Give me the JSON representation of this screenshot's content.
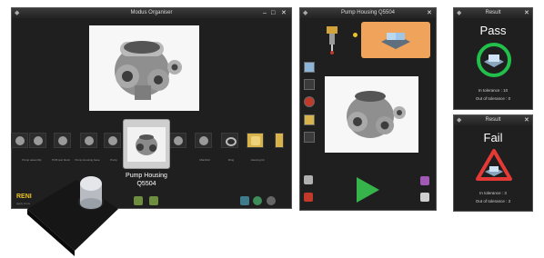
{
  "organiser": {
    "title": "Modus Organiser",
    "selected_name": "Pump Housing",
    "selected_code": "Q5504",
    "thumb_labels": [
      "Pump assembly",
      "PCB test block",
      "Pump Housing base",
      "Pump",
      "Pump",
      "Bracket",
      "Manifold",
      "Ring",
      "Collar",
      "Spare",
      "Housing lid"
    ],
    "brand": "RENI",
    "brand_sub": "apply innov"
  },
  "program": {
    "title": "Pump Housing Q5504"
  },
  "result_pass": {
    "title": "Result",
    "status": "Pass",
    "in_tol": "In tolerance : 10",
    "out_tol": "Out of tolerance : 0",
    "accent": "#22c04a"
  },
  "result_fail": {
    "title": "Result",
    "status": "Fail",
    "in_tol": "In tolerance : 3",
    "out_tol": "Out of tolerance : 3",
    "accent": "#e53935"
  }
}
